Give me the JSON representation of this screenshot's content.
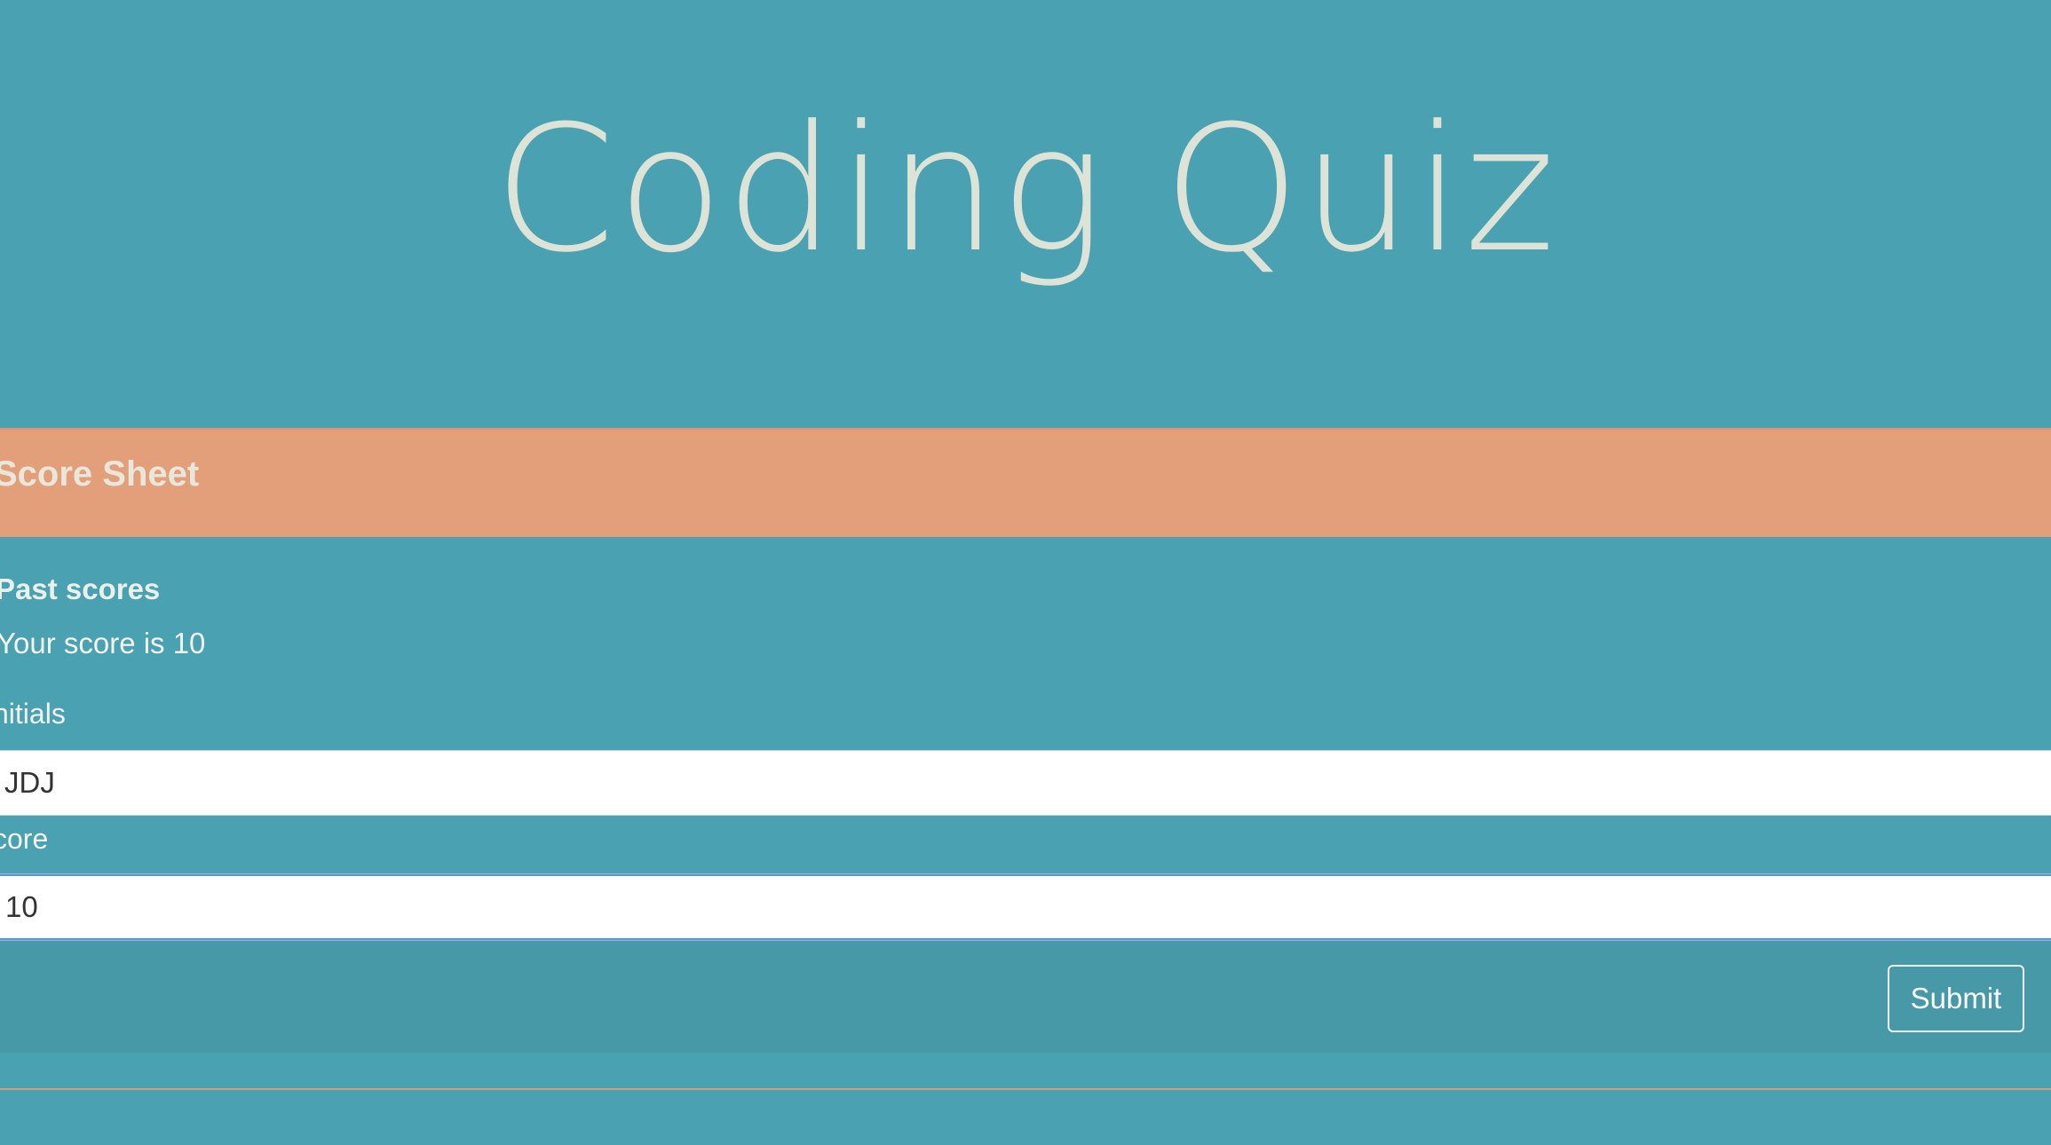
{
  "header": {
    "title": "Coding Quiz"
  },
  "card": {
    "header_title": "Score Sheet",
    "past_scores_label": "Past scores",
    "score_message": "Your score is 10",
    "initials_label": "nitials",
    "initials_value": "JDJ",
    "score_label": "core",
    "score_value": "10",
    "submit_label": "Submit"
  },
  "colors": {
    "background": "#4aa1b1",
    "header_band": "#e39f79",
    "footer": "#4799a7",
    "title_text": "#dde3d6",
    "focus_border": "#5b93d6"
  }
}
